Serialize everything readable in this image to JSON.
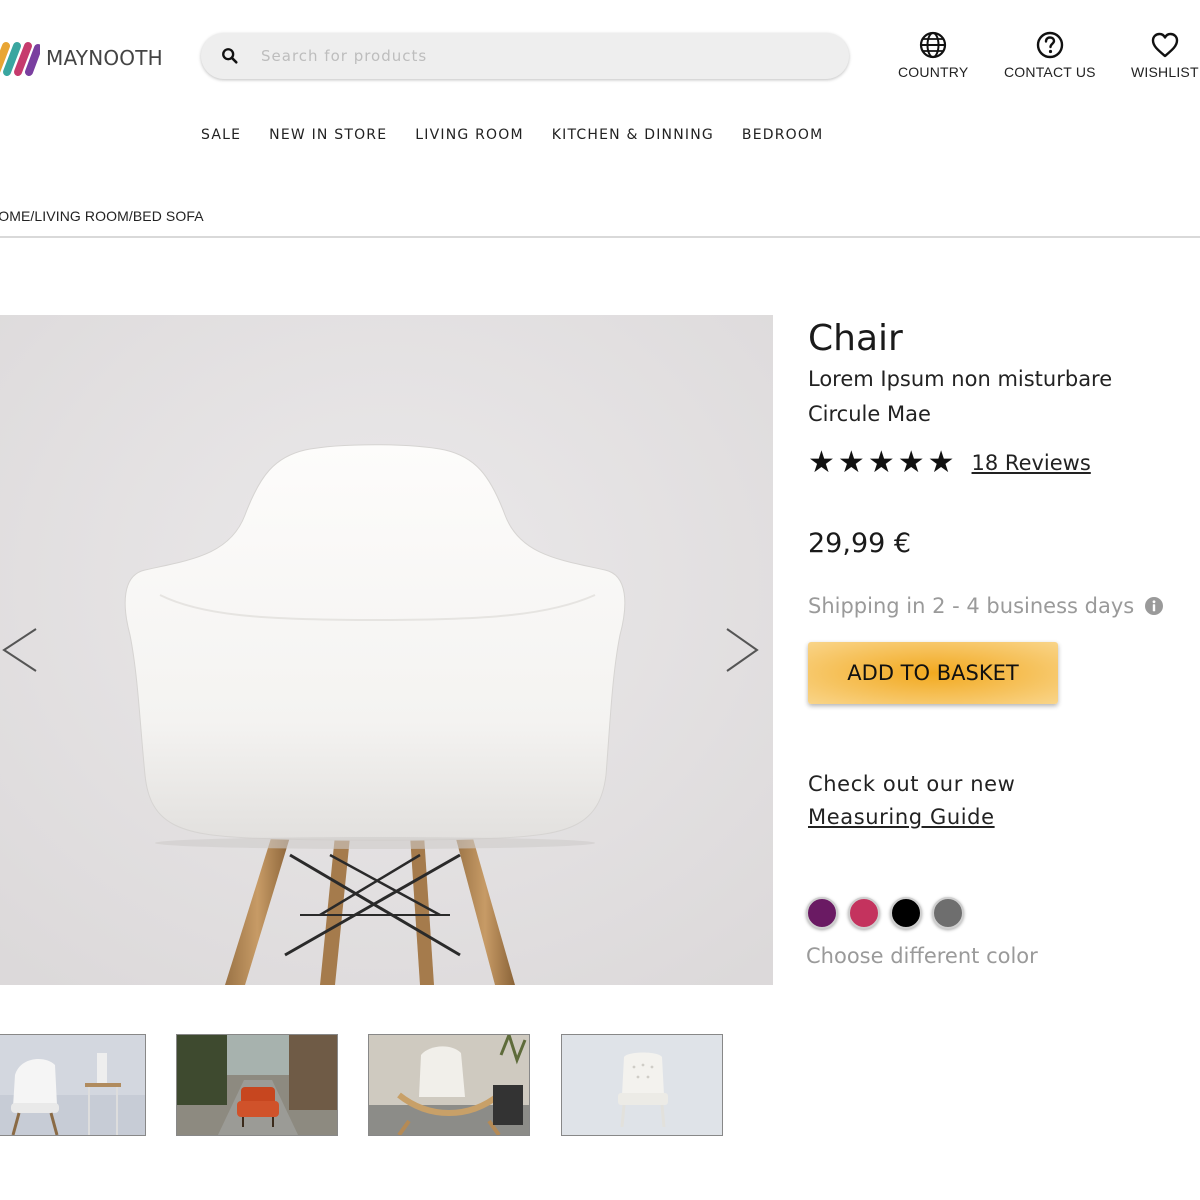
{
  "brand": {
    "name": "MAYNOOTH",
    "colors": [
      "#e8a534",
      "#c63b6d",
      "#3aa6a0",
      "#7a3fa0"
    ]
  },
  "search": {
    "placeholder": "Search for products"
  },
  "header_actions": [
    {
      "label": "COUNTRY",
      "icon": "globe-icon"
    },
    {
      "label": "CONTACT US",
      "icon": "help-circle-icon"
    },
    {
      "label": "WISHLIST",
      "icon": "heart-icon"
    }
  ],
  "nav": [
    "SALE",
    "NEW IN STORE",
    "LIVING ROOM",
    "KITCHEN & DINNING",
    "BEDROOM"
  ],
  "breadcrumb": "HOME/LIVING ROOM/BED SOFA",
  "product": {
    "title": "Chair",
    "subtitle": "Lorem Ipsum non misturbare Circule Mae",
    "rating": 5,
    "reviews": "18 Reviews",
    "price": "29,99 €",
    "shipping": "Shipping in 2 - 4 business days",
    "add_to_basket": "ADD TO BASKET",
    "guide_text": "Check out our new",
    "guide_link": "Measuring Guide",
    "color_label": "Choose different color",
    "colors": [
      "#6a1a63",
      "#c4335e",
      "#000000",
      "#6e6e6e"
    ]
  },
  "thumbnails": [
    "white-chair-with-side-table",
    "red-armchair-on-street",
    "white-wooden-chair-with-plant",
    "white-tufted-chair"
  ]
}
